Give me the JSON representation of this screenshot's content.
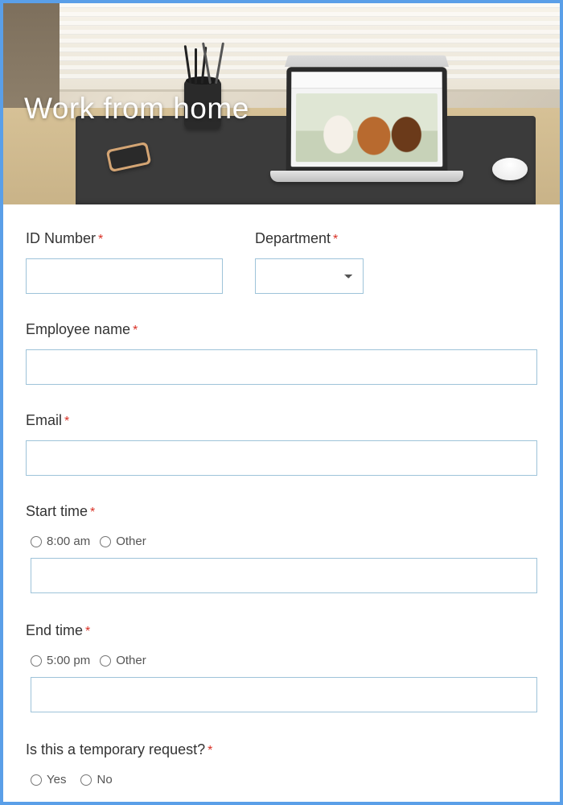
{
  "hero": {
    "title": "Work from home"
  },
  "fields": {
    "id_number": {
      "label": "ID Number",
      "required": "*"
    },
    "department": {
      "label": "Department",
      "required": "*"
    },
    "employee_name": {
      "label": "Employee name",
      "required": "*"
    },
    "email": {
      "label": "Email",
      "required": "*"
    },
    "start_time": {
      "label": "Start time",
      "required": "*",
      "opt1": "8:00 am",
      "opt_other": "Other"
    },
    "end_time": {
      "label": "End time",
      "required": "*",
      "opt1": "5:00 pm",
      "opt_other": "Other"
    },
    "temporary": {
      "label": "Is this a temporary request?",
      "required": "*",
      "yes": "Yes",
      "no": "No"
    }
  }
}
